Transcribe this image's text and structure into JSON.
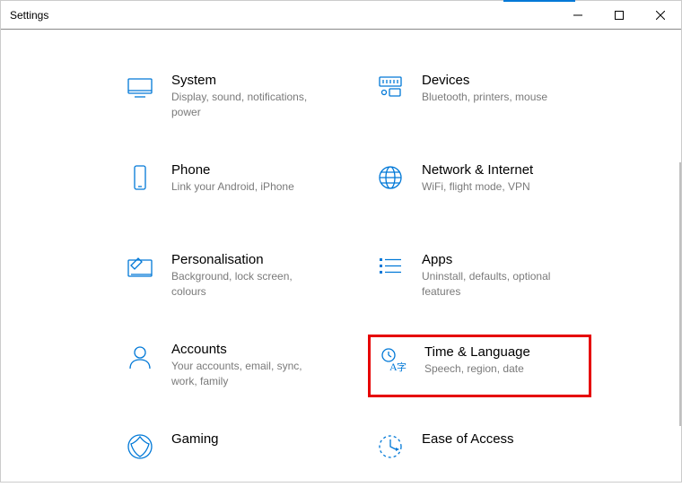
{
  "window": {
    "title": "Settings"
  },
  "categories": [
    {
      "id": "system",
      "title": "System",
      "desc": "Display, sound, notifications, power"
    },
    {
      "id": "devices",
      "title": "Devices",
      "desc": "Bluetooth, printers, mouse"
    },
    {
      "id": "phone",
      "title": "Phone",
      "desc": "Link your Android, iPhone"
    },
    {
      "id": "network",
      "title": "Network & Internet",
      "desc": "WiFi, flight mode, VPN"
    },
    {
      "id": "personalisation",
      "title": "Personalisation",
      "desc": "Background, lock screen, colours"
    },
    {
      "id": "apps",
      "title": "Apps",
      "desc": "Uninstall, defaults, optional features"
    },
    {
      "id": "accounts",
      "title": "Accounts",
      "desc": "Your accounts, email, sync, work, family"
    },
    {
      "id": "time-language",
      "title": "Time & Language",
      "desc": "Speech, region, date",
      "highlighted": true
    },
    {
      "id": "gaming",
      "title": "Gaming",
      "desc": ""
    },
    {
      "id": "ease-of-access",
      "title": "Ease of Access",
      "desc": ""
    }
  ]
}
